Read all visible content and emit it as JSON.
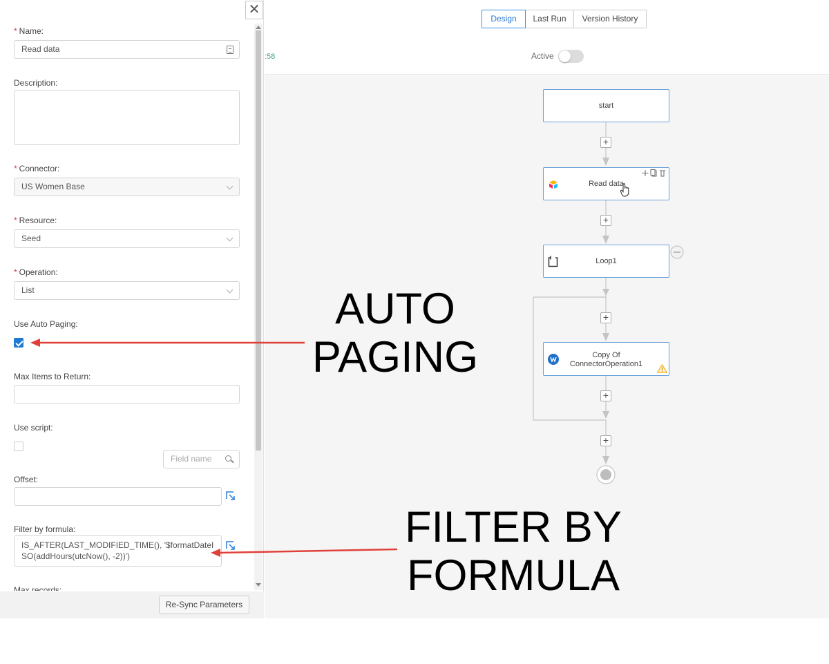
{
  "panel": {
    "close_glyph": "✕",
    "name": {
      "label": "Name:",
      "value": "Read data"
    },
    "description": {
      "label": "Description:"
    },
    "connector": {
      "label": "Connector:",
      "value": "US Women Base"
    },
    "resource": {
      "label": "Resource:",
      "value": "Seed"
    },
    "operation": {
      "label": "Operation:",
      "value": "List"
    },
    "use_auto_paging": {
      "label": "Use Auto Paging:",
      "checked": true
    },
    "max_items": {
      "label": "Max Items to Return:"
    },
    "use_script": {
      "label": "Use script:",
      "checked": false
    },
    "field_search": {
      "placeholder": "Field name"
    },
    "offset": {
      "label": "Offset:"
    },
    "filter_formula": {
      "label": "Filter by formula:",
      "value": "IS_AFTER(LAST_MODIFIED_TIME(), '$formatDateISO(addHours(utcNow(), -2))')"
    },
    "max_records": {
      "label": "Max records:"
    },
    "resync_label": "Re-Sync Parameters",
    "required_mark": "*"
  },
  "header": {
    "tabs": [
      {
        "label": "Design",
        "active": true
      },
      {
        "label": "Last Run",
        "active": false
      },
      {
        "label": "Version History",
        "active": false
      }
    ],
    "time_fragment": ":58",
    "active_label": "Active",
    "active_on": false
  },
  "flow": {
    "plus_glyph": "+",
    "nodes": {
      "start": "start",
      "read": "Read data",
      "loop": "Loop1",
      "copy_line1": "Copy Of",
      "copy_line2": "ConnectorOperation1"
    }
  },
  "annotations": {
    "auto_paging": [
      "AUTO",
      "PAGING"
    ],
    "filter_by_formula": [
      "FILTER BY",
      "FORMULA"
    ]
  },
  "colors": {
    "accent": "#2b7bd6",
    "arrow_red": "#e0403a",
    "required": "#e03a3a",
    "warning": "#f2b01e"
  }
}
